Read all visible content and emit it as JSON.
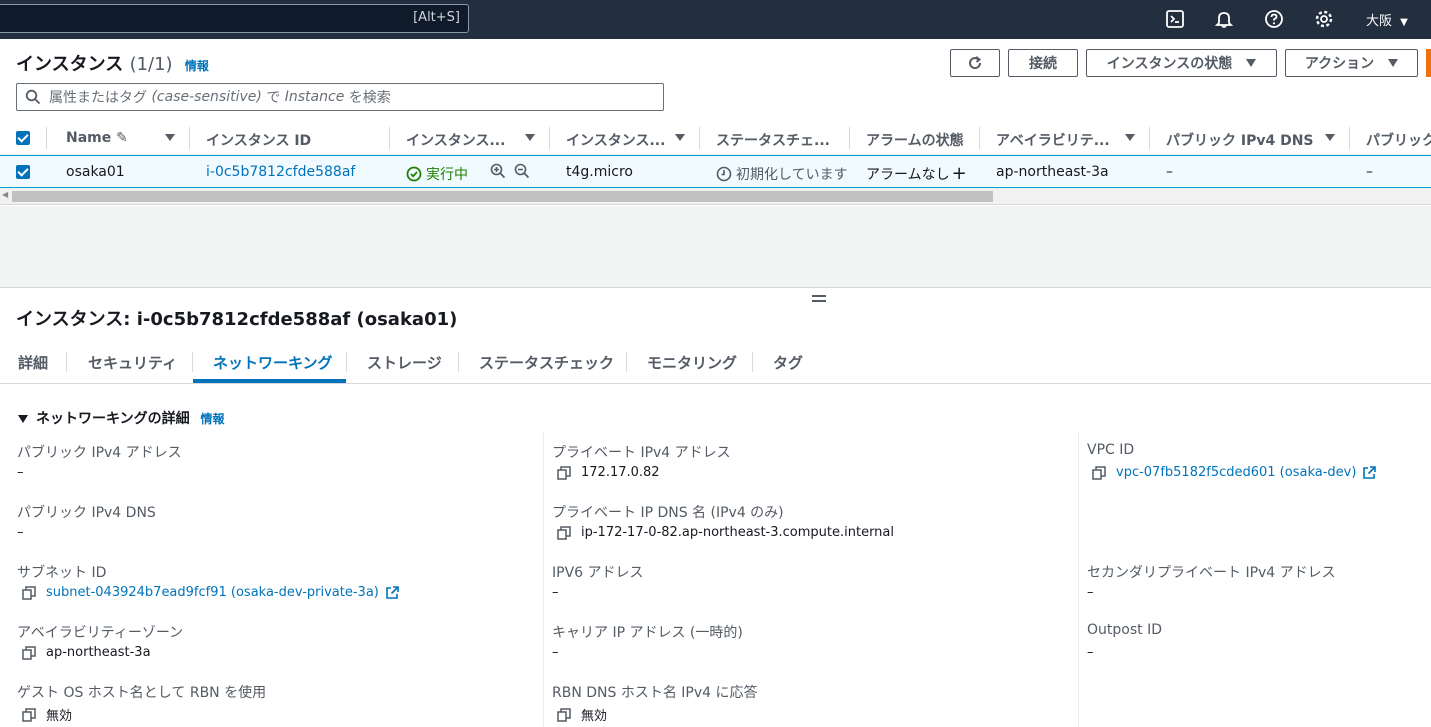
{
  "topbar": {
    "search_shortcut": "[Alt+S]",
    "region": "大阪",
    "icons": [
      "cloudshell-icon",
      "bell-icon",
      "help-icon",
      "gear-icon"
    ]
  },
  "instances": {
    "title": "インスタンス",
    "count": "(1/1)",
    "info": "情報",
    "buttons": {
      "refresh": "refresh-icon",
      "connect": "接続",
      "instance_state": "インスタンスの状態",
      "actions": "アクション"
    },
    "filter_placeholder_prefix": "属性またはタグ",
    "filter_placeholder_italic": "(case-sensitive)",
    "filter_placeholder_mid": "で",
    "filter_placeholder_italic2": "Instance",
    "filter_placeholder_suffix": "を検索"
  },
  "table": {
    "headers": [
      "Name",
      "インスタンス ID",
      "インスタンス...",
      "インスタンス...",
      "ステータスチェ...",
      "アラームの状態",
      "アベイラビリテ...",
      "パブリック IPv4 DNS",
      "パブリック"
    ],
    "rows": [
      {
        "name": "osaka01",
        "instance_id": "i-0c5b7812cfde588af",
        "state": "実行中",
        "type": "t4g.micro",
        "status_check": "初期化しています",
        "alarm": "アラームなし",
        "az": "ap-northeast-3a",
        "public_dns": "–",
        "public_ip": "–"
      }
    ]
  },
  "detail": {
    "title": "インスタンス: i-0c5b7812cfde588af (osaka01)",
    "tabs": [
      "詳細",
      "セキュリティ",
      "ネットワーキング",
      "ストレージ",
      "ステータスチェック",
      "モニタリング",
      "タグ"
    ],
    "active_tab": "ネットワーキング",
    "section_title": "ネットワーキングの詳細",
    "section_info": "情報",
    "col1": [
      {
        "label": "パブリック IPv4 アドレス",
        "value": "–"
      },
      {
        "label": "パブリック IPv4 DNS",
        "value": "–"
      },
      {
        "label": "サブネット ID",
        "value": "subnet-043924b7ead9fcf91 (osaka-dev-private-3a)"
      },
      {
        "label": "アベイラビリティーゾーン",
        "value": "ap-northeast-3a"
      },
      {
        "label": "ゲスト OS ホスト名として RBN を使用",
        "value": "無効"
      }
    ],
    "col2": [
      {
        "label": "プライベート IPv4 アドレス",
        "value": "172.17.0.82"
      },
      {
        "label": "プライベート IP DNS 名 (IPv4 のみ)",
        "value": "ip-172-17-0-82.ap-northeast-3.compute.internal"
      },
      {
        "label": "IPV6 アドレス",
        "value": "–"
      },
      {
        "label": "キャリア IP アドレス (一時的)",
        "value": "–"
      },
      {
        "label": "RBN DNS ホスト名 IPv4 に応答",
        "value": "無効"
      }
    ],
    "col3": [
      {
        "label": "VPC ID",
        "value": "vpc-07fb5182f5cded601 (osaka-dev)"
      },
      {
        "label": "セカンダリプライベート IPv4 アドレス",
        "value": "–"
      },
      {
        "label": "Outpost ID",
        "value": "–"
      }
    ]
  },
  "colors": {
    "nav_bg": "#232f3e",
    "link": "#0073bb",
    "running": "#1d8102",
    "row_selected_bg": "#f1faff",
    "accent_orange": "#ec7211"
  }
}
